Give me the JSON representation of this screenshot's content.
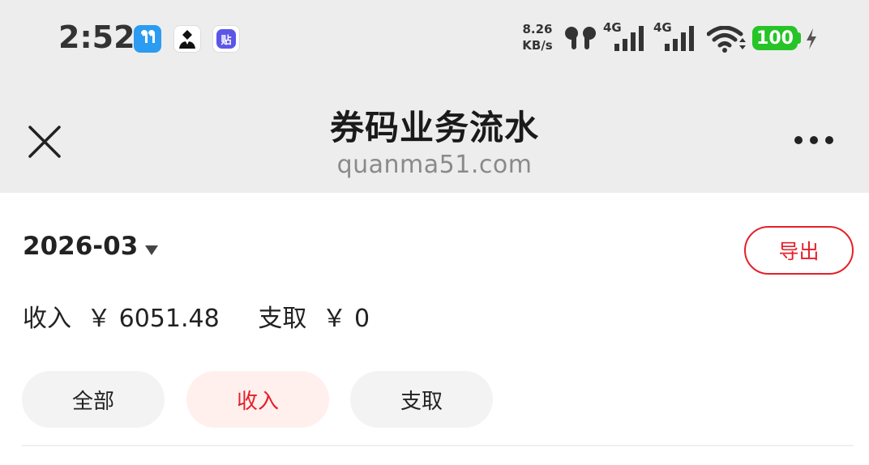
{
  "status_bar": {
    "time": "2:52",
    "net_speed_value": "8.26",
    "net_speed_unit": "KB/s",
    "signal1_label": "4G",
    "signal2_label": "4G",
    "battery": "100",
    "app_icon_3_label": "贴"
  },
  "header": {
    "title": "券码业务流水",
    "subtitle": "quanma51.com"
  },
  "filter_bar": {
    "month": "2026-03",
    "export_label": "导出"
  },
  "summary": {
    "income_label": "收入",
    "income_value": "￥ 6051.48",
    "expense_label": "支取",
    "expense_value": "￥ 0"
  },
  "tabs": [
    {
      "label": "全部",
      "active": false
    },
    {
      "label": "收入",
      "active": true
    },
    {
      "label": "支取",
      "active": false
    }
  ],
  "colors": {
    "accent": "#e5202a",
    "active_tab_bg": "#fff0ee",
    "inactive_tab_bg": "#f3f3f3",
    "header_bg": "#ededed",
    "battery": "#27c427"
  }
}
